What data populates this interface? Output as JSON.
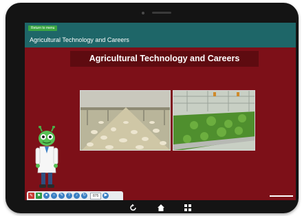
{
  "header": {
    "back_button_label": "Return to menu",
    "title": "Agricultural Technology and Careers"
  },
  "slide": {
    "title": "Agricultural Technology and Careers",
    "images": [
      {
        "name": "poultry-house-photo",
        "description_icon": "chickens-in-barn"
      },
      {
        "name": "greenhouse-photo",
        "description_icon": "plants-in-greenhouse"
      }
    ]
  },
  "toolbar": {
    "zoom_value": "875",
    "tools": [
      "notes-icon",
      "bookmark-icon",
      "globe-icon",
      "circle-tool-icon",
      "pen-icon",
      "help-icon",
      "audio-icon",
      "refresh-icon",
      "next-icon"
    ]
  },
  "nav_bar": {
    "icons": [
      "back-icon",
      "home-icon",
      "recents-icon"
    ]
  },
  "colors": {
    "slide_background": "#7d1018",
    "header_background": "#1e6668",
    "title_bar": "#5e0b10",
    "toolbar": "#e9ecef",
    "toolbar_button": "#3a7fc4"
  }
}
